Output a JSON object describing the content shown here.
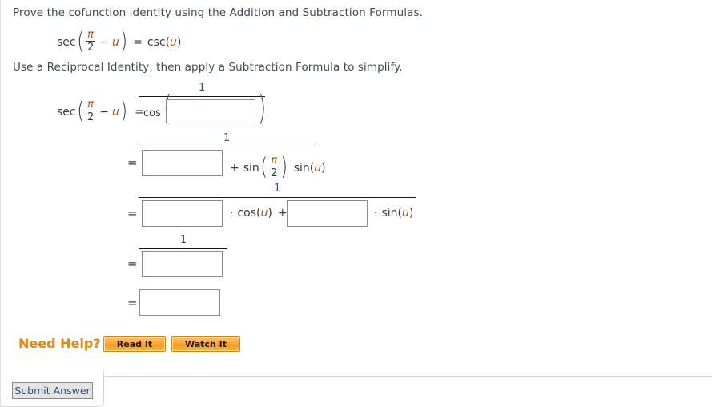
{
  "prompt": {
    "main": "Prove the cofunction identity using the Addition and Subtraction Formulas.",
    "hint": "Use a Reciprocal Identity, then apply a Subtraction Formula to simplify."
  },
  "identity": {
    "lhs_fn": "sec",
    "pi": "π",
    "two": "2",
    "minus": "−",
    "u": "u",
    "equals": "=",
    "rhs": "csc(",
    "rhs_close": ")"
  },
  "work": {
    "numerator": "1",
    "equals": "=",
    "line1": {
      "lhs_fn": "sec",
      "pi": "π",
      "two": "2",
      "minus": "−",
      "u": "u",
      "equals": "=",
      "denom_fn": "cos",
      "paren_open": "(",
      "paren_close": ")",
      "input_value": "",
      "input_placeholder": ""
    },
    "line2": {
      "plus": "+",
      "sin": "sin",
      "pi": "π",
      "two": "2",
      "sin_u": "sin(",
      "u": "u",
      "close": ")",
      "input_value": "",
      "input_placeholder": ""
    },
    "line3": {
      "dot": "·",
      "cos_u": "cos(",
      "u": "u",
      "close": ")",
      "plus": "+",
      "sin_u": "sin(",
      "input1_value": "",
      "input2_value": "",
      "input_placeholder": ""
    },
    "line4": {
      "input_value": "",
      "input_placeholder": ""
    },
    "line5": {
      "input_value": "",
      "input_placeholder": ""
    }
  },
  "help": {
    "label": "Need Help?",
    "read_it": "Read It",
    "watch_it": "Watch It"
  },
  "submit": {
    "label": "Submit Answer"
  },
  "colors": {
    "accent_orange": "#e8870d",
    "variable_orange": "#b0561a",
    "numeral_blue": "#30507c",
    "text": "#3f4a55",
    "input_border": "#8a8a8a"
  }
}
